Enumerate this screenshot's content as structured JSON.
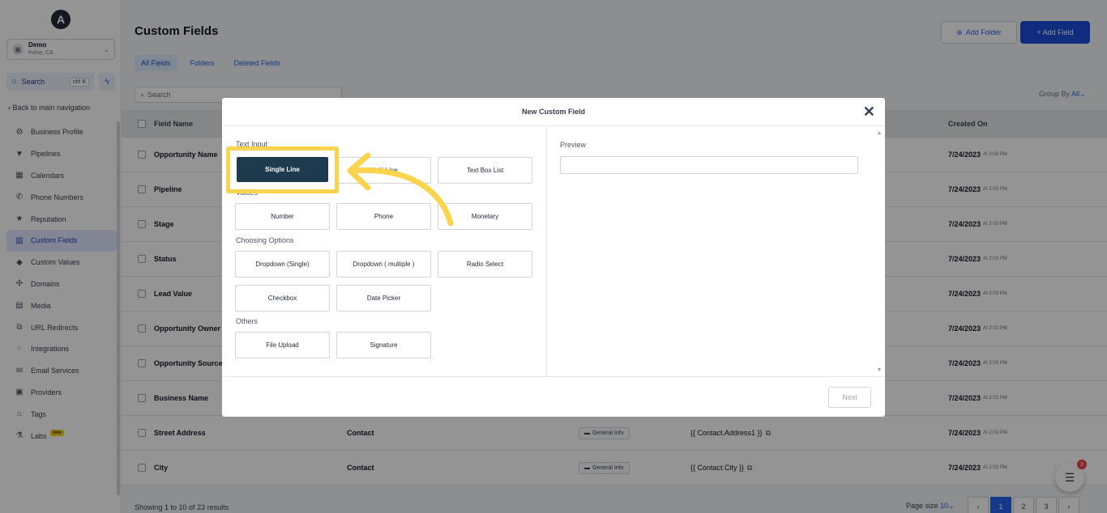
{
  "sidebar": {
    "logo": "A",
    "account": {
      "name": "Demo",
      "location": "Irvine, CA"
    },
    "search": {
      "label": "Search",
      "shortcut": "ctrl K"
    },
    "back_link": "Back to main navigation",
    "items": [
      {
        "label": "Business Profile",
        "icon": "gear-icon"
      },
      {
        "label": "Pipelines",
        "icon": "funnel-icon"
      },
      {
        "label": "Calendars",
        "icon": "calendar-icon"
      },
      {
        "label": "Phone Numbers",
        "icon": "phone-icon"
      },
      {
        "label": "Reputation",
        "icon": "star-icon"
      },
      {
        "label": "Custom Fields",
        "icon": "custom-fields-icon",
        "active": true
      },
      {
        "label": "Custom Values",
        "icon": "diamond-icon"
      },
      {
        "label": "Domains",
        "icon": "domain-icon"
      },
      {
        "label": "Media",
        "icon": "media-icon"
      },
      {
        "label": "URL Redirects",
        "icon": "link-icon"
      },
      {
        "label": "Integrations",
        "icon": "integrations-icon"
      },
      {
        "label": "Email Services",
        "icon": "email-icon"
      },
      {
        "label": "Providers",
        "icon": "providers-icon"
      },
      {
        "label": "Tags",
        "icon": "tag-icon"
      },
      {
        "label": "Labs",
        "icon": "flask-icon",
        "badge": "new"
      }
    ]
  },
  "header": {
    "title": "Custom Fields",
    "add_folder": "Add Folder",
    "add_field": "+ Add Field"
  },
  "tabs": [
    "All Fields",
    "Folders",
    "Deleted Fields"
  ],
  "search": {
    "placeholder": "Search"
  },
  "group_by": {
    "label": "Group By",
    "value": "All"
  },
  "table": {
    "columns": [
      "Field Name",
      "Created On"
    ],
    "rows": [
      {
        "name": "Opportunity Name",
        "date": "7/24/2023",
        "time": "At 2:03 PM"
      },
      {
        "name": "Pipeline",
        "date": "7/24/2023",
        "time": "At 2:03 PM"
      },
      {
        "name": "Stage",
        "date": "7/24/2023",
        "time": "At 2:03 PM"
      },
      {
        "name": "Status",
        "date": "7/24/2023",
        "time": "At 2:03 PM"
      },
      {
        "name": "Lead Value",
        "date": "7/24/2023",
        "time": "At 2:03 PM"
      },
      {
        "name": "Opportunity Owner",
        "date": "7/24/2023",
        "time": "At 2:03 PM"
      },
      {
        "name": "Opportunity Source",
        "date": "7/24/2023",
        "time": "At 2:03 PM"
      },
      {
        "name": "Business Name",
        "date": "7/24/2023",
        "time": "At 2:03 PM"
      },
      {
        "name": "Street Address",
        "object": "Contact",
        "folder": "General Info",
        "key": "{{ Contact.Address1 }}",
        "date": "7/24/2023",
        "time": "At 2:03 PM"
      },
      {
        "name": "City",
        "object": "Contact",
        "folder": "General Info",
        "key": "{{ Contact.City }}",
        "date": "7/24/2023",
        "time": "At 2:03 PM"
      }
    ]
  },
  "footer": {
    "showing": "Showing 1 to 10 of 23 results",
    "page_size_label": "Page size",
    "page_size_value": "10",
    "pages": [
      "1",
      "2",
      "3"
    ],
    "chat_badge": "3"
  },
  "modal": {
    "title": "New Custom Field",
    "groups": {
      "text_input": "Text Input",
      "values": "Values",
      "choosing_options": "Choosing Options",
      "others": "Others"
    },
    "buttons": {
      "single_line": "Single Line",
      "multi_line": "Multi Line",
      "text_box_list": "Text Box List",
      "number": "Number",
      "phone": "Phone",
      "monetary": "Monetary",
      "dropdown_single": "Dropdown (Single)",
      "dropdown_multiple": "Dropdown ( multiple )",
      "radio_select": "Radio Select",
      "checkbox": "Checkbox",
      "date_picker": "Date Picker",
      "file_upload": "File Upload",
      "signature": "Signature"
    },
    "preview_label": "Preview",
    "next": "Next"
  },
  "colors": {
    "accent": "#2563eb",
    "highlight": "#fcd34d",
    "selected_button": "#1e3a4f"
  }
}
